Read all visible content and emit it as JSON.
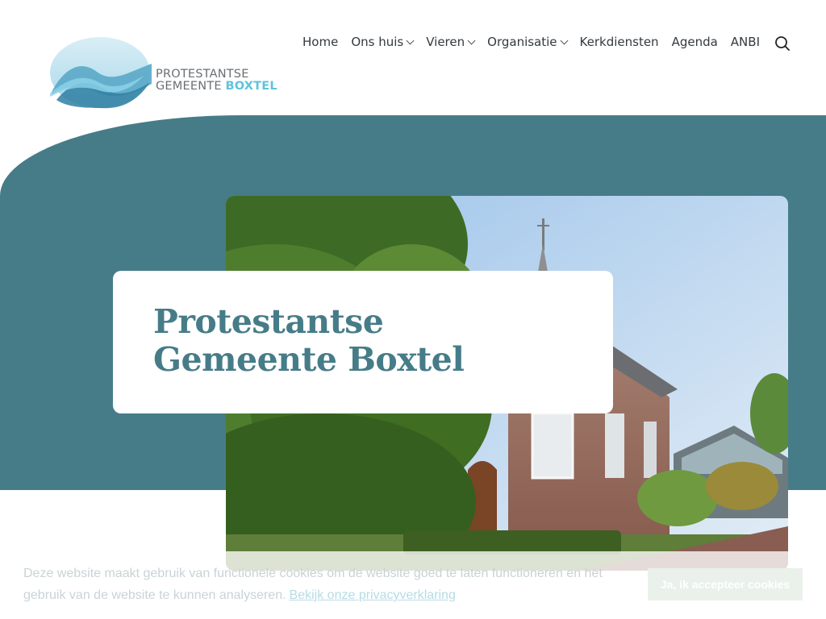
{
  "logo": {
    "line1": "PROTESTANTSE",
    "line2a": "GEMEENTE",
    "line2b": "BOXTEL"
  },
  "nav": {
    "items": [
      {
        "label": "Home",
        "has_dropdown": false
      },
      {
        "label": "Ons huis",
        "has_dropdown": true
      },
      {
        "label": "Vieren",
        "has_dropdown": true
      },
      {
        "label": "Organisatie",
        "has_dropdown": true
      },
      {
        "label": "Kerkdiensten",
        "has_dropdown": false
      },
      {
        "label": "Agenda",
        "has_dropdown": false
      },
      {
        "label": "ANBI",
        "has_dropdown": false
      }
    ],
    "search_icon": "search-icon"
  },
  "hero": {
    "title": "Protestantse Gemeente Boxtel",
    "image_alt": "church-photo"
  },
  "cookie": {
    "text": "Deze website maakt gebruik van functionele cookies om de website goed te laten functioneren en het gebruik van de website te kunnen analyseren.",
    "link": "Bekijk onze privacyverklaring",
    "button": "Ja, ik accepteer cookies"
  },
  "colors": {
    "brand_teal": "#467c88",
    "logo_accent": "#5fc3dc"
  }
}
